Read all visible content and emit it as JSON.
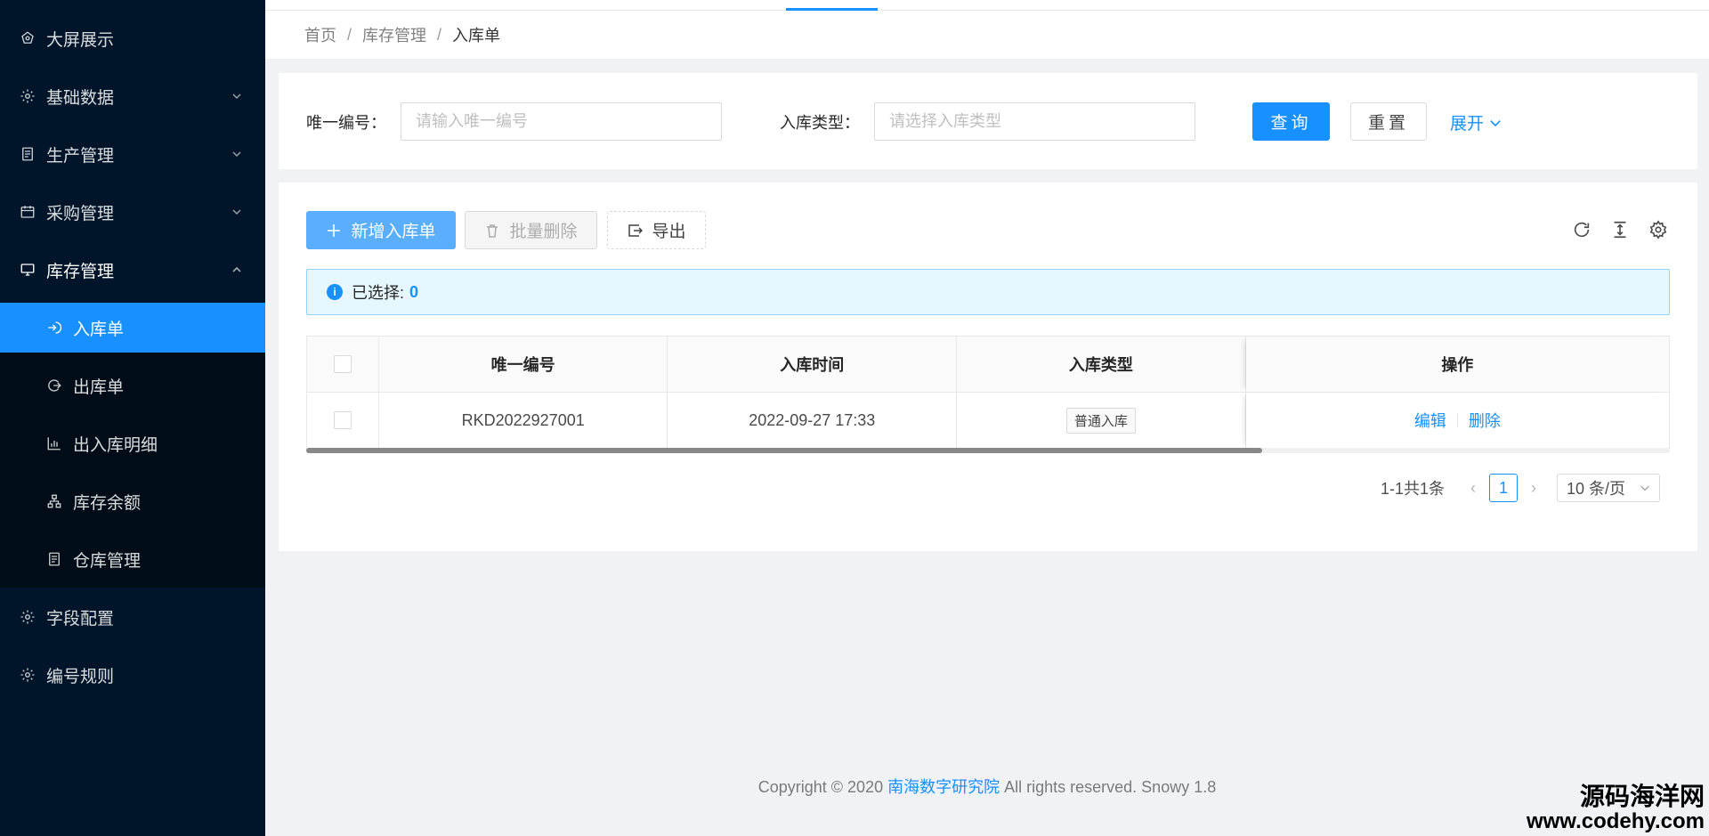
{
  "sidebar": {
    "items": [
      {
        "label": "大屏展示",
        "icon": "dashboard-icon",
        "has_arrow": false
      },
      {
        "label": "基础数据",
        "icon": "gear-icon",
        "has_arrow": true
      },
      {
        "label": "生产管理",
        "icon": "document-icon",
        "has_arrow": true
      },
      {
        "label": "采购管理",
        "icon": "calendar-icon",
        "has_arrow": true
      },
      {
        "label": "库存管理",
        "icon": "monitor-icon",
        "has_arrow": true,
        "open": true
      }
    ],
    "subitems": [
      {
        "label": "入库单",
        "icon": "login-icon",
        "active": true
      },
      {
        "label": "出库单",
        "icon": "logout-icon",
        "active": false
      },
      {
        "label": "出入库明细",
        "icon": "bar-chart-icon",
        "active": false
      },
      {
        "label": "库存余额",
        "icon": "cluster-icon",
        "active": false
      },
      {
        "label": "仓库管理",
        "icon": "document-icon",
        "active": false
      }
    ],
    "bottom_items": [
      {
        "label": "字段配置",
        "icon": "gear-icon"
      },
      {
        "label": "编号规则",
        "icon": "gear-icon"
      }
    ]
  },
  "breadcrumb": {
    "items": [
      "首页",
      "库存管理"
    ],
    "current": "入库单",
    "separator": "/"
  },
  "search": {
    "code_label": "唯一编号：",
    "code_placeholder": "请输入唯一编号",
    "type_label": "入库类型：",
    "type_placeholder": "请选择入库类型",
    "query_label": "查询",
    "reset_label": "重置",
    "expand_label": "展开"
  },
  "toolbar": {
    "add_label": "新增入库单",
    "batch_delete_label": "批量删除",
    "export_label": "导出"
  },
  "alert": {
    "selected_label": "已选择:",
    "selected_count": "0"
  },
  "table": {
    "columns": [
      "唯一编号",
      "入库时间",
      "入库类型",
      "操作"
    ],
    "rows": [
      {
        "code": "RKD2022927001",
        "time": "2022-09-27 17:33",
        "type": "普通入库",
        "edit": "编辑",
        "delete": "删除"
      }
    ]
  },
  "pagination": {
    "total": "1-1共1条",
    "current_page": "1",
    "page_size": "10 条/页"
  },
  "footer": {
    "prefix": "Copyright © 2020",
    "org": "南海数字研究院",
    "suffix": "All rights reserved. Snowy 1.8"
  },
  "watermark": {
    "cn": "源码海洋网",
    "url": "www.codehy.com"
  },
  "colors": {
    "primary": "#1890ff",
    "sidebar_bg": "#001529",
    "submenu_bg": "#000c17"
  }
}
